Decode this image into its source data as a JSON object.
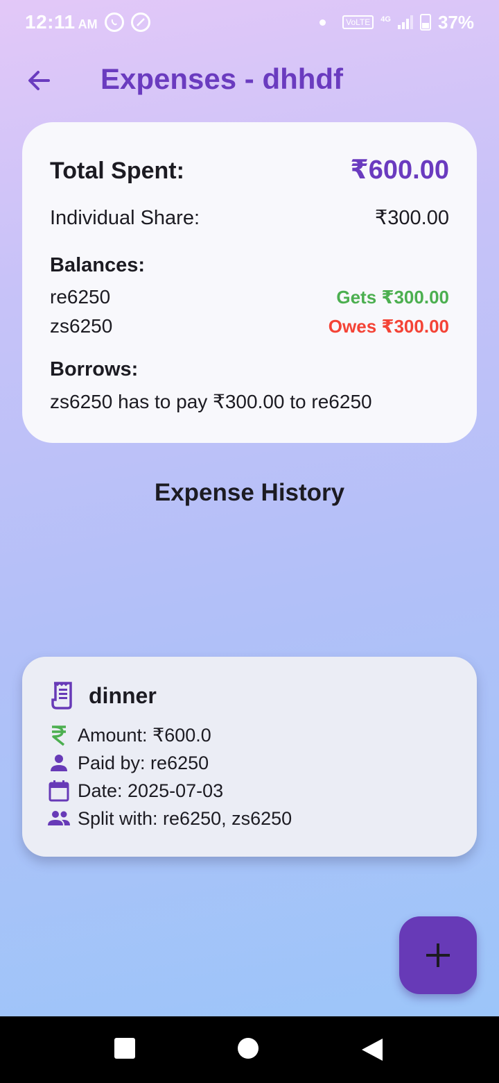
{
  "status_bar": {
    "time": "12:11",
    "ampm": "AM",
    "volte": "VoLTE",
    "network": "4G",
    "battery": "37%"
  },
  "app_bar": {
    "title": "Expenses - dhhdf"
  },
  "summary": {
    "total_label": "Total Spent:",
    "total_value": "₹600.00",
    "share_label": "Individual Share:",
    "share_value": "₹300.00",
    "balances_heading": "Balances:",
    "balances": [
      {
        "name": "re6250",
        "status": "Gets ₹300.00",
        "type": "gets"
      },
      {
        "name": "zs6250",
        "status": "Owes ₹300.00",
        "type": "owes"
      }
    ],
    "borrows_heading": "Borrows:",
    "borrows": [
      "zs6250 has to pay ₹300.00 to re6250"
    ]
  },
  "history": {
    "title": "Expense History",
    "expenses": [
      {
        "title": "dinner",
        "amount": "Amount: ₹600.0",
        "paid_by": "Paid by: re6250",
        "date": "Date: 2025-07-03",
        "split_with": "Split with: re6250, zs6250"
      }
    ]
  },
  "colors": {
    "accent": "#673ab7",
    "gets": "#4caf50",
    "owes": "#f44336"
  },
  "icons": {
    "back": "arrow-back-icon",
    "expense": "receipt-icon",
    "amount": "rupee-icon",
    "paid_by": "person-icon",
    "date": "calendar-icon",
    "split": "group-icon",
    "fab": "add-icon"
  }
}
